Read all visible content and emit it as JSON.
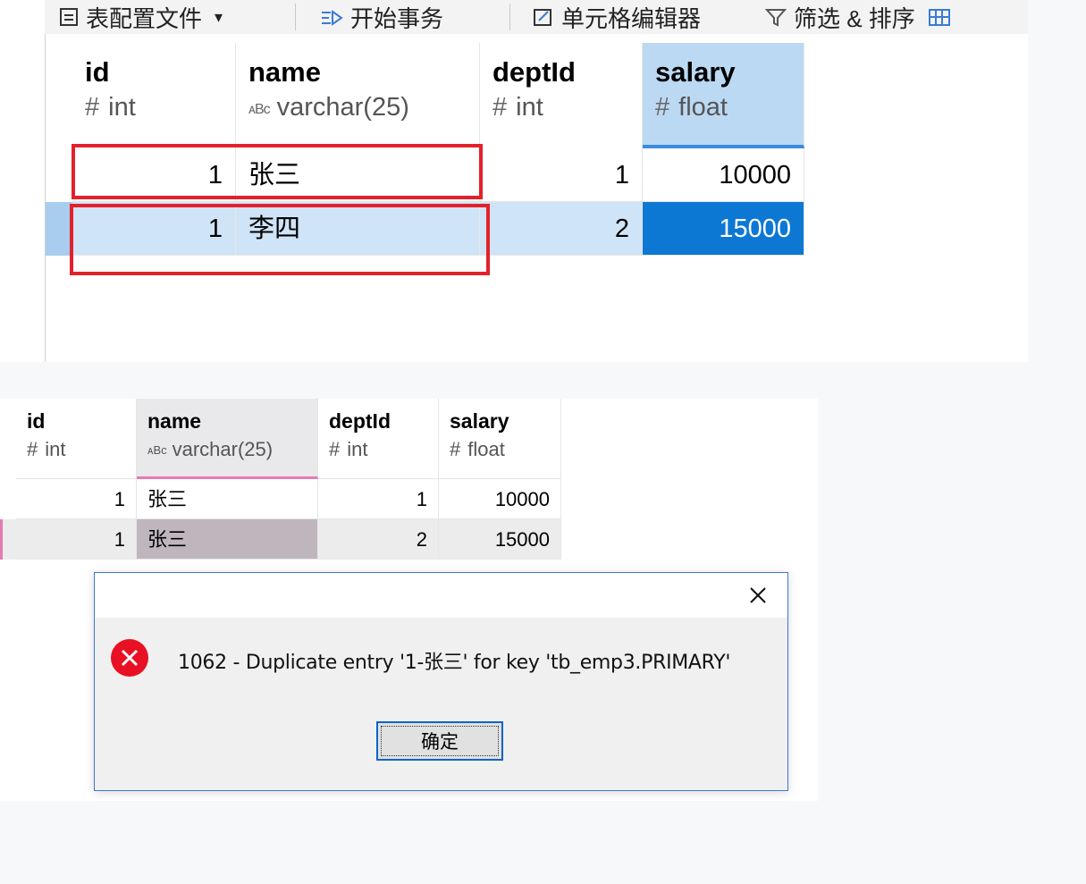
{
  "toolbar": {
    "items": [
      "表配置文件",
      "开始事务",
      "单元格编辑器",
      "筛选 & 排序"
    ]
  },
  "top_grid": {
    "columns": [
      {
        "name": "id",
        "type": "int",
        "icon": "#"
      },
      {
        "name": "name",
        "type": "varchar(25)",
        "icon": "ABC"
      },
      {
        "name": "deptId",
        "type": "int",
        "icon": "#"
      },
      {
        "name": "salary",
        "type": "float",
        "icon": "#"
      }
    ],
    "rows": [
      [
        "1",
        "张三",
        "1",
        "10000"
      ],
      [
        "1",
        "李四",
        "2",
        "15000"
      ]
    ]
  },
  "bottom_grid": {
    "columns": [
      {
        "name": "id",
        "type": "int",
        "icon": "#"
      },
      {
        "name": "name",
        "type": "varchar(25)",
        "icon": "ABC"
      },
      {
        "name": "deptId",
        "type": "int",
        "icon": "#"
      },
      {
        "name": "salary",
        "type": "float",
        "icon": "#"
      }
    ],
    "rows": [
      [
        "1",
        "张三",
        "1",
        "10000"
      ],
      [
        "1",
        "张三",
        "2",
        "15000"
      ]
    ]
  },
  "error_dialog": {
    "message": "1062 - Duplicate entry '1-张三' for key 'tb_emp3.PRIMARY'",
    "ok_label": "确定"
  },
  "colors": {
    "selection_blue": "#0c78d3",
    "highlight_red": "#e2212b",
    "error_red": "#e81123"
  }
}
